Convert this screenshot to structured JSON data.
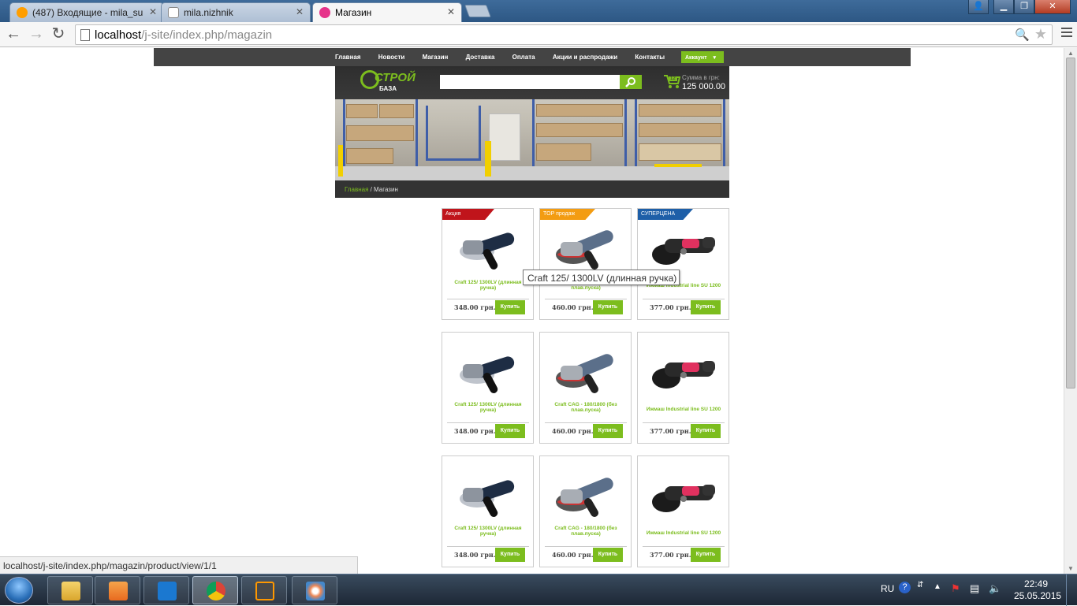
{
  "browser": {
    "tabs": [
      {
        "title": "(487) Входящие - mila_su",
        "active": false
      },
      {
        "title": "mila.nizhnik",
        "active": false
      },
      {
        "title": "Магазин",
        "active": true
      }
    ],
    "url_host": "localhost",
    "url_path": "/j-site/index.php/magazin",
    "icons": {
      "back": "back-arrow-icon",
      "forward": "forward-arrow-icon",
      "reload": "reload-icon",
      "page": "page-icon",
      "zoom": "zoom-icon",
      "bookmark": "star-icon",
      "menu": "hamburger-menu-icon"
    },
    "window_controls": [
      "user-icon",
      "minimize-icon",
      "maximize-icon",
      "close-icon"
    ]
  },
  "site": {
    "nav": [
      "Главная",
      "Новости",
      "Магазин",
      "Доставка",
      "Оплата",
      "Акции и распродажи",
      "Контакты"
    ],
    "account": "Аккаунт",
    "logo_top": "СТРОЙ",
    "logo_bottom": "БАЗА",
    "search_placeholder": "",
    "cart_count": "12",
    "cart_sum_label": "Сумма в грн:",
    "cart_sum": "125 000.00",
    "breadcrumb_home": "Главная",
    "breadcrumb_sep": " / ",
    "breadcrumb_current": "Магазин",
    "accent_color": "#7cbd1e"
  },
  "products": [
    {
      "name": "Craft 125/ 1300LV (длинная ручка)",
      "price": "348.00 грн.",
      "buy": "Купить",
      "badge": "Акция",
      "badge_color": "#c0141b",
      "image": "angle-grinder-blue-icon"
    },
    {
      "name": "Craft CAG - 180/1800 (без плав.пуска)",
      "price": "460.00 грн.",
      "buy": "Купить",
      "badge": "TOP продаж",
      "badge_color": "#f39c12",
      "image": "angle-grinder-grey-icon"
    },
    {
      "name": "Ижмаш Industrial line SU 1200",
      "price": "377.00 грн.",
      "buy": "Купить",
      "badge": "СУПЕРЦЕНА",
      "badge_color": "#1e5fa8",
      "image": "angle-grinder-pink-icon"
    },
    {
      "name": "Craft 125/ 1300LV (длинная ручка)",
      "price": "348.00 грн.",
      "buy": "Купить",
      "badge": "",
      "badge_color": "",
      "image": "angle-grinder-blue-icon"
    },
    {
      "name": "Craft CAG - 180/1800 (без плав.пуска)",
      "price": "460.00 грн.",
      "buy": "Купить",
      "badge": "",
      "badge_color": "",
      "image": "angle-grinder-grey-icon"
    },
    {
      "name": "Ижмаш Industrial line SU 1200",
      "price": "377.00 грн.",
      "buy": "Купить",
      "badge": "",
      "badge_color": "",
      "image": "angle-grinder-pink-icon"
    },
    {
      "name": "Craft 125/ 1300LV (длинная ручка)",
      "price": "348.00 грн.",
      "buy": "Купить",
      "badge": "",
      "badge_color": "",
      "image": "angle-grinder-blue-icon"
    },
    {
      "name": "Craft CAG - 180/1800 (без плав.пуска)",
      "price": "460.00 грн.",
      "buy": "Купить",
      "badge": "",
      "badge_color": "",
      "image": "angle-grinder-grey-icon"
    },
    {
      "name": "Ижмаш Industrial line SU 1200",
      "price": "377.00 грн.",
      "buy": "Купить",
      "badge": "",
      "badge_color": "",
      "image": "angle-grinder-pink-icon"
    }
  ],
  "tooltip": "Craft 125/ 1300LV (длинная  ручка)",
  "status_url": "localhost/j-site/index.php/magazin/product/view/1/1",
  "taskbar": {
    "apps": [
      "explorer-icon",
      "media-player-icon",
      "maxthon-icon",
      "chrome-icon",
      "sublime-text-icon",
      "paint-icon"
    ],
    "active_app": "chrome-icon",
    "lang": "RU",
    "time": "22:49",
    "date": "25.05.2015",
    "tray_icons": [
      "help-icon",
      "network-arrows-icon",
      "show-hidden-icon",
      "action-center-icon",
      "network-icon",
      "volume-icon"
    ]
  }
}
